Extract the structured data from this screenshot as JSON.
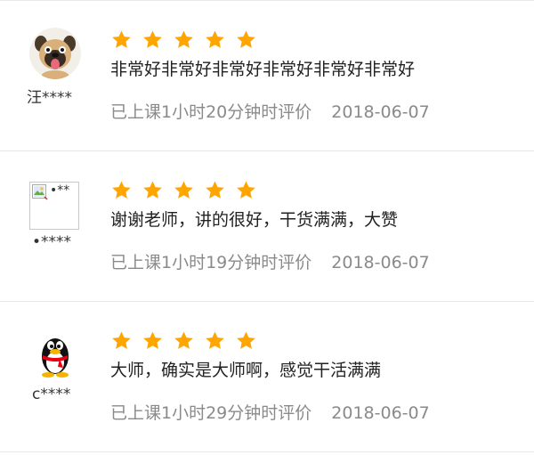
{
  "reviews": [
    {
      "user": "汪****",
      "avatar": "pug-dog-avatar",
      "rating": 5,
      "comment": "非常好非常好非常好非常好非常好非常好",
      "time_text": "已上课1小时20分钟时评价",
      "date": "2018-06-07"
    },
    {
      "user": "•****",
      "avatar": "broken-image",
      "avatar_alt": "•**",
      "rating": 5,
      "comment": "谢谢老师，讲的很好，干货满满，大赞",
      "time_text": "已上课1小时19分钟时评价",
      "date": "2018-06-07"
    },
    {
      "user": "c****",
      "avatar": "qq-penguin-avatar",
      "rating": 5,
      "comment": "大师，确实是大师啊，感觉干活满满",
      "time_text": "已上课1小时29分钟时评价",
      "date": "2018-06-07"
    }
  ],
  "colors": {
    "star": "#ffa500",
    "comment_text": "#222222",
    "meta_text": "#8a8a8a",
    "divider": "#e8e8e8"
  }
}
